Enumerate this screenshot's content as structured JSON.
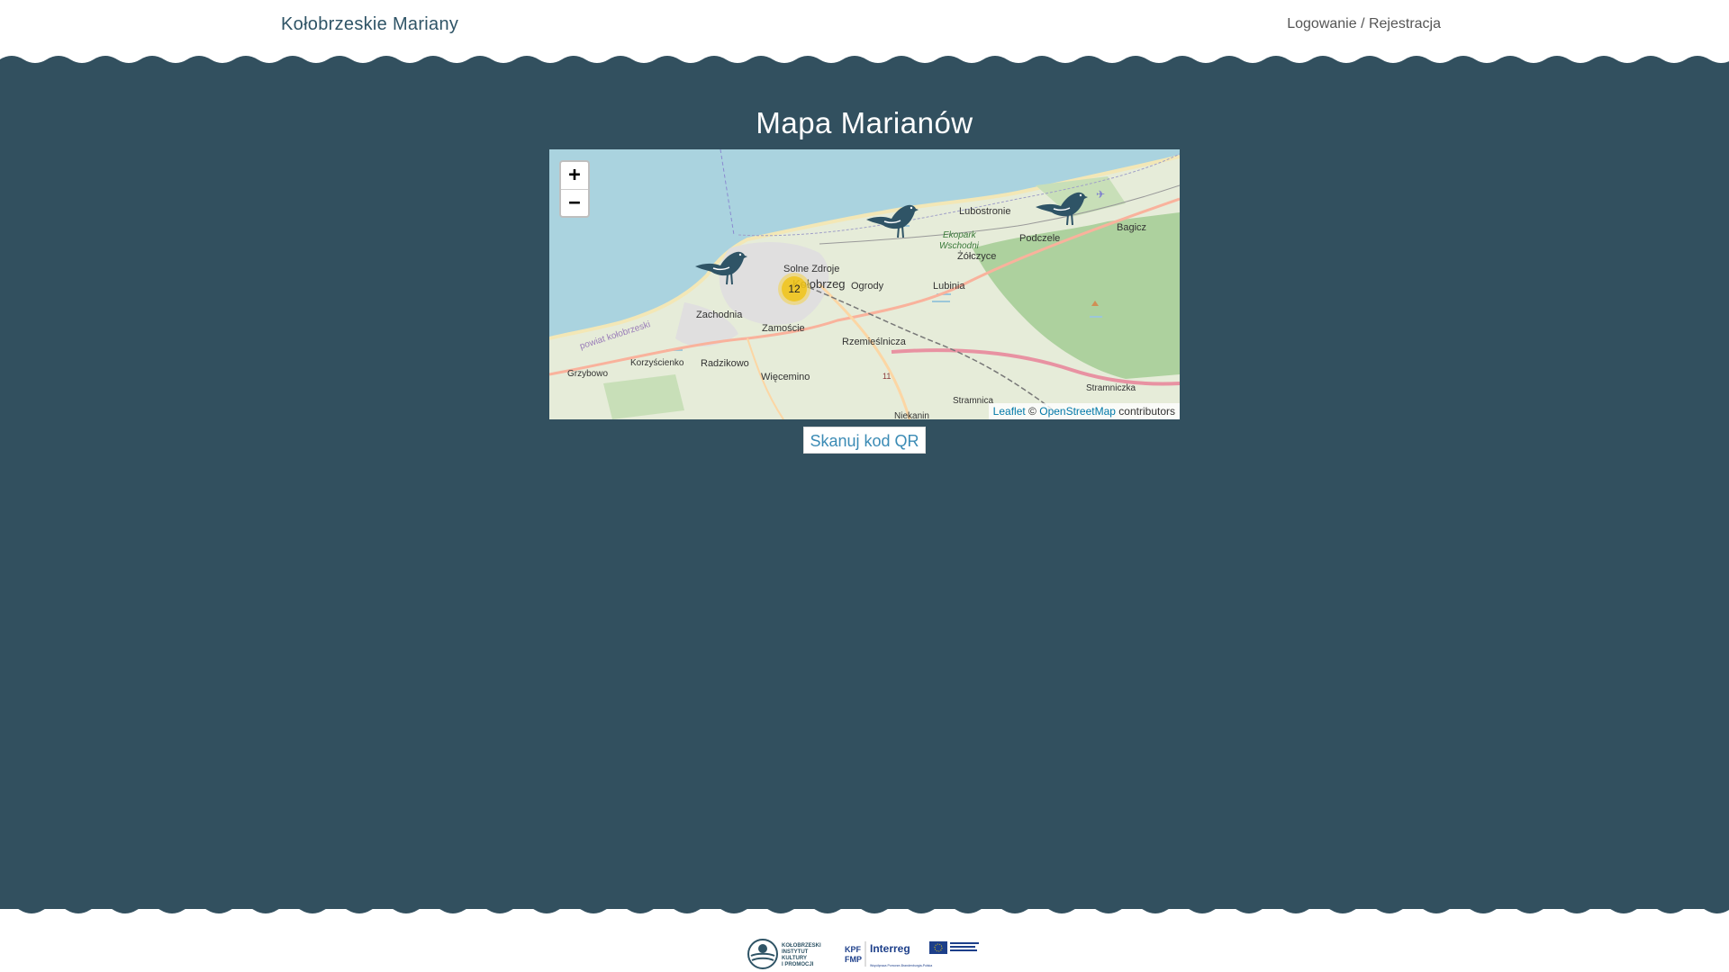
{
  "header": {
    "brand": "Kołobrzeskie Mariany",
    "login_link": "Logowanie / Rejestracja"
  },
  "main": {
    "title": "Mapa Marianów",
    "qr_button": "Skanuj kod QR"
  },
  "map": {
    "zoom_in": "+",
    "zoom_out": "−",
    "attribution": {
      "leaflet": "Leaflet",
      "sep": "©",
      "osm": "OpenStreetMap",
      "suffix": "contributors"
    },
    "cluster_count": "12",
    "places": {
      "kolobrzeg": "Kołobrzeg",
      "solne_zdroje": "Solne Zdroje",
      "ogrody": "Ogrody",
      "lubinia": "Lubinia",
      "lubostronie": "Lubostronie",
      "podczele": "Podczele",
      "bagicz": "Bagicz",
      "zolczyce": "Żółczyce",
      "ekopark": "Ekopark",
      "wschodni": "Wschodni",
      "zachodnia": "Zachodnia",
      "zamoscie": "Zamoście",
      "rzemieslnicza": "Rzemieślnicza",
      "korzyscienko": "Korzyścienko",
      "radzikowo": "Radzikowo",
      "grzybowo": "Grzybowo",
      "wiecemino": "Więcemino",
      "stramnica": "Stramnica",
      "stramniczka": "Stramniczka",
      "niekanin": "Niekanin",
      "powiat": "powiat kołobrzeski",
      "road": "11"
    }
  },
  "footer": {
    "logo1_line1": "KOŁOBRZESKI",
    "logo1_line2": "INSTYTUT",
    "logo1_line3": "KULTURY",
    "logo1_line4": "I PROMOCJI",
    "logo2_line1": "KPF",
    "logo2_line2": "FMP",
    "logo3": "Interreg",
    "logo3_sub": "Współpraca Pomorze-Brandenburgia-Polska"
  },
  "colors": {
    "band": "#32505f",
    "sea": "#aad3df",
    "land": "#dfe9d4",
    "forest": "#add19e",
    "marker": "#2f5466",
    "cluster": "#f0c20c"
  }
}
